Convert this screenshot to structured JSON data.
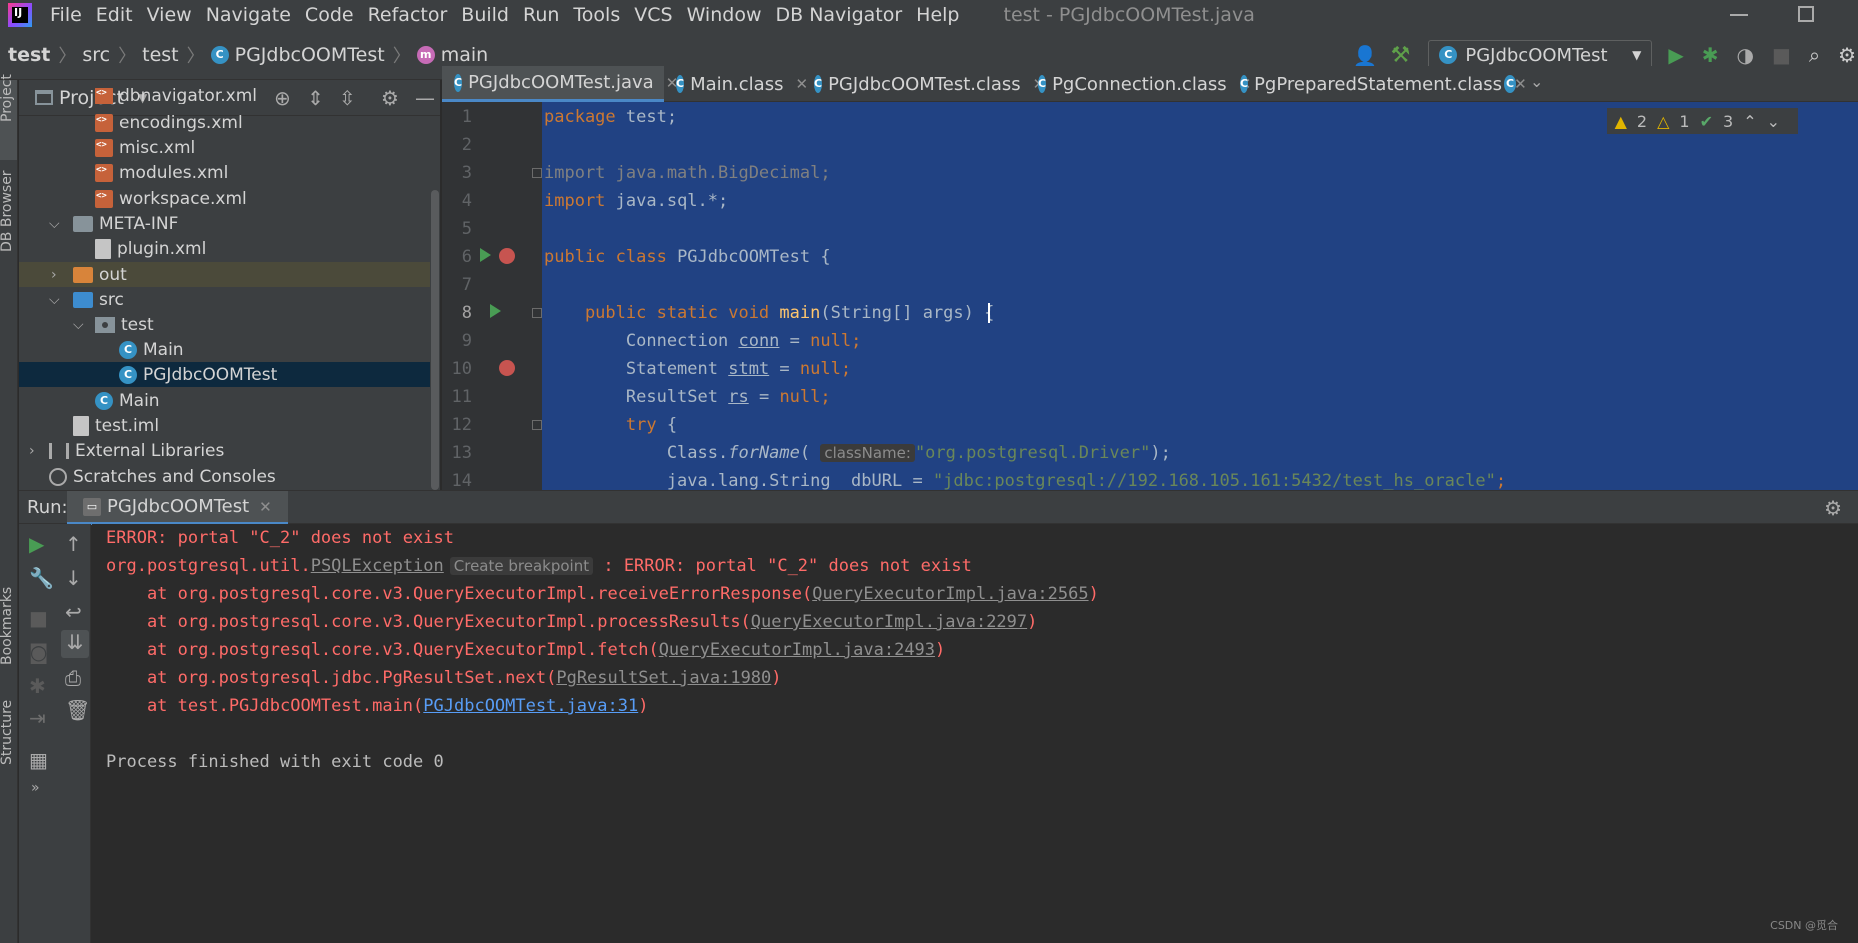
{
  "menu": {
    "items": [
      "File",
      "Edit",
      "View",
      "Navigate",
      "Code",
      "Refactor",
      "Build",
      "Run",
      "Tools",
      "VCS",
      "Window",
      "DB Navigator",
      "Help"
    ],
    "window_title": "test - PGJdbcOOMTest.java"
  },
  "nav": {
    "crumbs": [
      "test",
      "src",
      "test",
      "PGJdbcOOMTest",
      "main"
    ],
    "run_config": "PGJdbcOOMTest"
  },
  "left_stripe": {
    "project": "Project",
    "db_browser": "DB Browser",
    "bookmarks": "Bookmarks",
    "structure": "Structure"
  },
  "project": {
    "title": "Project",
    "tree": [
      {
        "label": "dbnavigator.xml",
        "icon": "xml-icon"
      },
      {
        "label": "encodings.xml",
        "icon": "xml-icon"
      },
      {
        "label": "misc.xml",
        "icon": "xml-icon"
      },
      {
        "label": "modules.xml",
        "icon": "xml-icon"
      },
      {
        "label": "workspace.xml",
        "icon": "xml-icon"
      },
      {
        "label": "META-INF",
        "icon": "folder-icon"
      },
      {
        "label": "plugin.xml",
        "icon": "plugin-file-icon"
      },
      {
        "label": "out",
        "icon": "folder-icon"
      },
      {
        "label": "src",
        "icon": "folder-icon"
      },
      {
        "label": "test",
        "icon": "package-icon"
      },
      {
        "label": "Main",
        "icon": "class-icon"
      },
      {
        "label": "PGJdbcOOMTest",
        "icon": "class-icon"
      },
      {
        "label": "Main",
        "icon": "class-icon"
      },
      {
        "label": "test.iml",
        "icon": "module-file-icon"
      },
      {
        "label": "External Libraries",
        "icon": "library-icon"
      },
      {
        "label": "Scratches and Consoles",
        "icon": "scratch-icon"
      }
    ]
  },
  "editor": {
    "tabs": [
      "PGJdbcOOMTest.java",
      "Main.class",
      "PGJdbcOOMTest.class",
      "PgConnection.class",
      "PgPreparedStatement.class"
    ],
    "inspections": {
      "errors": "2",
      "warnings": "1",
      "ok": "3"
    },
    "line_numbers": [
      "1",
      "2",
      "3",
      "4",
      "5",
      "6",
      "7",
      "8",
      "9",
      "10",
      "11",
      "12",
      "13",
      "14"
    ],
    "code": {
      "l1a": "package",
      "l1b": " test;",
      "l3": "import java.math.BigDecimal;",
      "l4a": "import",
      "l4b": " java.sql.*;",
      "l6a": "public class",
      "l6b": " PGJdbcOOMTest {",
      "l8a": "    public static void",
      "l8b": " main",
      "l8c": "(String[] args) {",
      "l9a": "        Connection ",
      "l9b": "conn",
      "l9c": " = ",
      "l9d": "null",
      "l9e": ";",
      "l10a": "        Statement ",
      "l10b": "stmt",
      "l10c": " = ",
      "l10d": "null",
      "l10e": ";",
      "l11a": "        ResultSet ",
      "l11b": "rs",
      "l11c": " = ",
      "l11d": "null",
      "l11e": ";",
      "l12a": "        try",
      "l12b": " {",
      "l13a": "            Class.",
      "l13b": "forName",
      "l13c": "(",
      "l13hint": "className:",
      "l13d": "\"org.postgresql.Driver\"",
      "l13e": ");",
      "l14a": "            java.lang.String  dbURL = ",
      "l14b": "\"jdbc:postgresql://192.168.105.161:5432/test_hs_oracle\"",
      "l14c": ";"
    }
  },
  "run": {
    "label": "Run:",
    "tab": "PGJdbcOOMTest",
    "console": {
      "c1": "ERROR: portal \"C_2\" does not exist",
      "c2a": "org.postgresql.util.",
      "c2b": "PSQLException",
      "c2hint": "Create breakpoint",
      "c2c": " : ERROR: portal \"C_2\" does not exist",
      "c3a": "    at org.postgresql.core.v3.QueryExecutorImpl.receiveErrorResponse(",
      "c3b": "QueryExecutorImpl.java:2565",
      "c3c": ")",
      "c4a": "    at org.postgresql.core.v3.QueryExecutorImpl.processResults(",
      "c4b": "QueryExecutorImpl.java:2297",
      "c4c": ")",
      "c5a": "    at org.postgresql.core.v3.QueryExecutorImpl.fetch(",
      "c5b": "QueryExecutorImpl.java:2493",
      "c5c": ")",
      "c6a": "    at org.postgresql.jdbc.PgResultSet.next(",
      "c6b": "PgResultSet.java:1980",
      "c6c": ")",
      "c7a": "    at test.PGJdbcOOMTest.main(",
      "c7b": "PGJdbcOOMTest.java:31",
      "c7c": ")",
      "c9": "Process finished with exit code 0"
    }
  },
  "watermark": "CSDN @觅合"
}
